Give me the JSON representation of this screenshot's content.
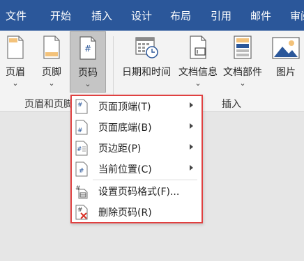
{
  "tabs": [
    "文件",
    "开始",
    "插入",
    "设计",
    "布局",
    "引用",
    "邮件",
    "审阅"
  ],
  "ribbon": {
    "buttons": [
      {
        "label": "页眉",
        "chevron": "⌄"
      },
      {
        "label": "页脚",
        "chevron": "⌄"
      },
      {
        "label": "页码",
        "chevron": "⌄"
      },
      {
        "label": "日期和时间"
      },
      {
        "label": "文档信息",
        "chevron": "⌄"
      },
      {
        "label": "文档部件",
        "chevron": "⌄"
      },
      {
        "label": "图片"
      }
    ],
    "groups": [
      "页眉和页脚",
      "插入"
    ],
    "page_icon_glyph": "#"
  },
  "page_number_menu": {
    "items": [
      {
        "label": "页面顶端(T)",
        "icon": "page-top-icon"
      },
      {
        "label": "页面底端(B)",
        "icon": "page-bottom-icon"
      },
      {
        "label": "页边距(P)",
        "icon": "page-margin-icon"
      },
      {
        "label": "当前位置(C)",
        "icon": "current-position-icon"
      },
      {
        "label": "设置页码格式(F)...",
        "icon": "format-page-number-icon"
      },
      {
        "label": "删除页码(R)",
        "icon": "remove-page-number-icon"
      }
    ],
    "icon_glyph": "#",
    "highlight_color": "#e04040"
  },
  "colors": {
    "tabbar": "#2b579a",
    "ribbon": "#f3f3f3",
    "highlight": "#e04040"
  }
}
